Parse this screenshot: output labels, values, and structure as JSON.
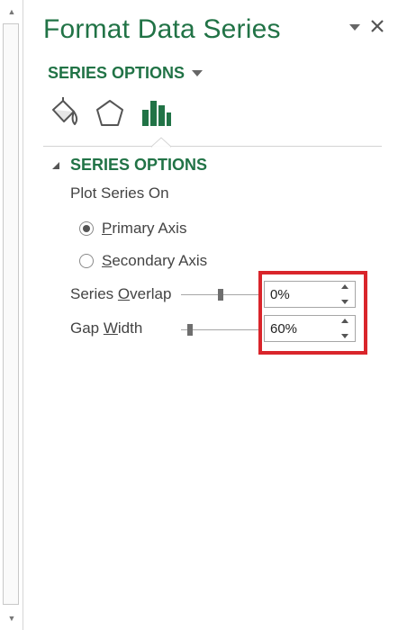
{
  "pane": {
    "title": "Format Data Series",
    "options_dropdown_label": "SERIES OPTIONS",
    "tabs": [
      {
        "name": "Fill & Line",
        "icon": "paint-bucket-icon"
      },
      {
        "name": "Effects",
        "icon": "pentagon-icon"
      },
      {
        "name": "Series Options",
        "icon": "bar-chart-icon",
        "selected": true
      }
    ]
  },
  "section": {
    "header": "SERIES OPTIONS",
    "plot_series_on_label": "Plot Series On",
    "primary_axis": {
      "label_mnemonic": "P",
      "label_rest": "rimary Axis",
      "checked": true
    },
    "secondary_axis": {
      "label_mnemonic": "S",
      "label_rest": "econdary Axis",
      "checked": false
    },
    "series_overlap": {
      "label_before": "Series ",
      "label_mnemonic": "O",
      "label_after": "verlap",
      "value": "0%",
      "slider_fraction": 0.5
    },
    "gap_width": {
      "label_before": "Gap ",
      "label_mnemonic": "W",
      "label_after": "idth",
      "value": "60%",
      "slider_fraction": 0.12
    }
  },
  "colors": {
    "accent_green": "#217346",
    "highlight_red": "#d9252b",
    "text": "#444444"
  }
}
